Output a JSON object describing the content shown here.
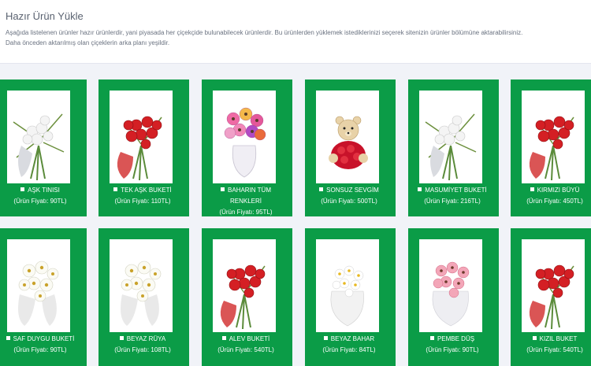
{
  "page": {
    "title": "Hazır Ürün Yükle",
    "desc_line1": "Aşağıda listelenen ürünler hazır ürünlerdir, yani piyasada her çiçekçide bulunabilecek ürünlerdir. Bu ürünlerden yüklemek istediklerinizi seçerek sitenizin ürünler bölümüne aktarabilirsiniz.",
    "desc_line2": "Daha önceden aktarılmış olan çiçeklerin arka planı yeşildir."
  },
  "colors": {
    "card_green": "#0b9c47"
  },
  "products": [
    {
      "name": "AŞK TINISI",
      "price": "(Ürün Fiyatı: 90TL)",
      "image": "white-rose-bouquet"
    },
    {
      "name": "TEK AŞK BUKETİ",
      "price": "(Ürün Fiyatı: 110TL)",
      "image": "red-rose-bouquet"
    },
    {
      "name": "BAHARIN TÜM RENKLERİ",
      "price": "(Ürün Fiyatı: 95TL)",
      "image": "mixed-gerbera-bouquet"
    },
    {
      "name": "SONSUZ SEVGİM",
      "price": "(Ürün Fiyatı: 500TL)",
      "image": "teddy-bear-roses"
    },
    {
      "name": "MASUMİYET BUKETİ",
      "price": "(Ürün Fiyatı: 216TL)",
      "image": "white-rose-bouquet"
    },
    {
      "name": "KIRMIZI BÜYÜ",
      "price": "(Ürün Fiyatı: 450TL)",
      "image": "red-rose-bouquet"
    },
    {
      "name": "SAF DUYGU BUKETİ",
      "price": "(Ürün Fiyatı: 90TL)",
      "image": "white-gerbera-bouquet"
    },
    {
      "name": "BEYAZ RÜYA",
      "price": "(Ürün Fiyatı: 108TL)",
      "image": "white-gerbera-bouquet"
    },
    {
      "name": "ALEV BUKETİ",
      "price": "(Ürün Fiyatı: 540TL)",
      "image": "red-rose-bouquet"
    },
    {
      "name": "BEYAZ BAHAR",
      "price": "(Ürün Fiyatı: 84TL)",
      "image": "white-daisy-bouquet"
    },
    {
      "name": "PEMBE DÜŞ",
      "price": "(Ürün Fiyatı: 90TL)",
      "image": "pink-gerbera-bouquet"
    },
    {
      "name": "KIZIL BUKET",
      "price": "(Ürün Fiyatı: 540TL)",
      "image": "red-rose-bouquet"
    }
  ]
}
